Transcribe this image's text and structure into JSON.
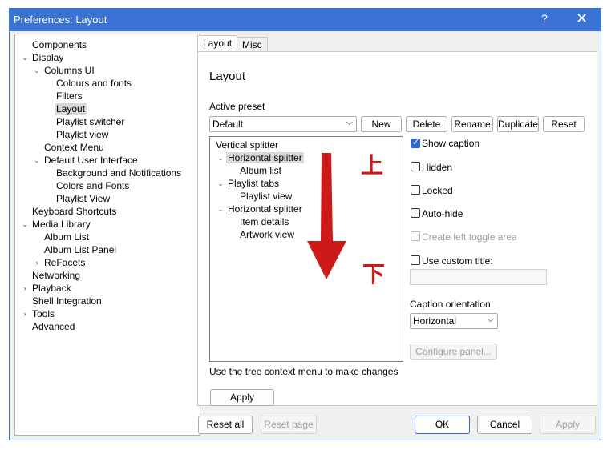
{
  "window": {
    "title": "Preferences: Layout",
    "help_icon": "?",
    "close_icon": "✕"
  },
  "tree": [
    {
      "label": "Components",
      "level": 0
    },
    {
      "label": "Display",
      "level": 0,
      "exp": "open"
    },
    {
      "label": "Columns UI",
      "level": 1,
      "exp": "open"
    },
    {
      "label": "Colours and fonts",
      "level": 2
    },
    {
      "label": "Filters",
      "level": 2
    },
    {
      "label": "Layout",
      "level": 2,
      "selected": true
    },
    {
      "label": "Playlist switcher",
      "level": 2
    },
    {
      "label": "Playlist view",
      "level": 2
    },
    {
      "label": "Context Menu",
      "level": 1
    },
    {
      "label": "Default User Interface",
      "level": 1,
      "exp": "open"
    },
    {
      "label": "Background and Notifications",
      "level": 2
    },
    {
      "label": "Colors and Fonts",
      "level": 2
    },
    {
      "label": "Playlist View",
      "level": 2
    },
    {
      "label": "Keyboard Shortcuts",
      "level": 0
    },
    {
      "label": "Media Library",
      "level": 0,
      "exp": "open"
    },
    {
      "label": "Album List",
      "level": 1
    },
    {
      "label": "Album List Panel",
      "level": 1
    },
    {
      "label": "ReFacets",
      "level": 1,
      "exp": "closed"
    },
    {
      "label": "Networking",
      "level": 0
    },
    {
      "label": "Playback",
      "level": 0,
      "exp": "closed"
    },
    {
      "label": "Shell Integration",
      "level": 0
    },
    {
      "label": "Tools",
      "level": 0,
      "exp": "closed"
    },
    {
      "label": "Advanced",
      "level": 0
    }
  ],
  "tabs": {
    "layout": "Layout",
    "misc": "Misc"
  },
  "layout": {
    "heading": "Layout",
    "active_preset_label": "Active preset",
    "preset_value": "Default",
    "buttons": {
      "new": "New",
      "delete": "Delete",
      "rename": "Rename",
      "duplicate": "Duplicate",
      "reset": "Reset"
    },
    "tree": [
      {
        "label": "Vertical splitter",
        "level": 0
      },
      {
        "label": "Horizontal splitter",
        "level": 1,
        "exp": "open",
        "selected": true
      },
      {
        "label": "Album list",
        "level": 2
      },
      {
        "label": "Playlist tabs",
        "level": 1,
        "exp": "open"
      },
      {
        "label": "Playlist view",
        "level": 2
      },
      {
        "label": "Horizontal splitter",
        "level": 1,
        "exp": "open"
      },
      {
        "label": "Item details",
        "level": 2
      },
      {
        "label": "Artwork view",
        "level": 2
      }
    ],
    "hint": "Use the tree context menu to make changes",
    "apply": "Apply",
    "options": {
      "show_caption": "Show caption",
      "hidden": "Hidden",
      "locked": "Locked",
      "auto_hide": "Auto-hide",
      "create_left_toggle": "Create left toggle area",
      "use_custom_title": "Use custom title:"
    },
    "caption_orientation_label": "Caption orientation",
    "caption_orientation_value": "Horizontal",
    "configure_panel": "Configure panel..."
  },
  "annotation": {
    "top": "上",
    "bottom": "下",
    "arrow_color": "#cc1a1a"
  },
  "footer": {
    "reset_all": "Reset all",
    "reset_page": "Reset page",
    "ok": "OK",
    "cancel": "Cancel",
    "apply": "Apply"
  },
  "colors": {
    "titlebar": "#3a73d4",
    "accent": "#2e69c8"
  }
}
